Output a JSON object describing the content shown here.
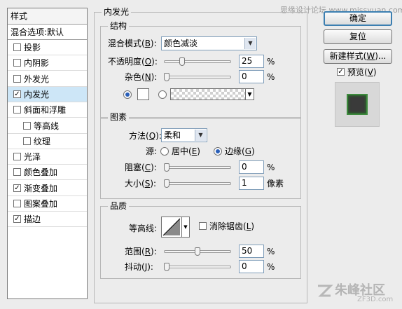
{
  "watermark_top": "思缘设计论坛 www.missyuan.com",
  "watermark_bottom": "朱峰社区",
  "watermark_bottom_sub": "ZF3D.com",
  "sidebar": {
    "header": "样式",
    "blend_options": "混合选项:默认",
    "items": [
      {
        "label": "投影",
        "checked": false
      },
      {
        "label": "内阴影",
        "checked": false
      },
      {
        "label": "外发光",
        "checked": false
      },
      {
        "label": "内发光",
        "checked": true,
        "selected": true
      },
      {
        "label": "斜面和浮雕",
        "checked": false
      },
      {
        "label": "等高线",
        "checked": false,
        "sub": true
      },
      {
        "label": "纹理",
        "checked": false,
        "sub": true
      },
      {
        "label": "光泽",
        "checked": false
      },
      {
        "label": "颜色叠加",
        "checked": false
      },
      {
        "label": "渐变叠加",
        "checked": true
      },
      {
        "label": "图案叠加",
        "checked": false
      },
      {
        "label": "描边",
        "checked": true
      }
    ]
  },
  "panel": {
    "title": "内发光",
    "structure": {
      "title": "结构",
      "blend_mode_label": "混合模式(",
      "blend_mode_key": "B",
      "blend_mode_value": "颜色减淡",
      "opacity_label": "不透明度(",
      "opacity_key": "O",
      "opacity_value": "25",
      "opacity_level": 0.25,
      "noise_label": "杂色(",
      "noise_key": "N",
      "noise_value": "0",
      "noise_level": 0,
      "percent": "%"
    },
    "elements": {
      "title": "图素",
      "method_label": "方法(",
      "method_key": "Q",
      "method_value": "柔和",
      "source_label": "源:",
      "source_center": "居中(",
      "source_center_key": "E",
      "source_edge": "边缘(",
      "source_edge_key": "G",
      "choke_label": "阻塞(",
      "choke_key": "C",
      "choke_value": "0",
      "choke_level": 0,
      "size_label": "大小(",
      "size_key": "S",
      "size_value": "1",
      "size_unit": "像素",
      "percent": "%"
    },
    "quality": {
      "title": "品质",
      "contour_label": "等高线:",
      "antialias_label": "消除锯齿(",
      "antialias_key": "L",
      "range_label": "范围(",
      "range_key": "R",
      "range_value": "50",
      "range_level": 0.5,
      "jitter_label": "抖动(",
      "jitter_key": "J",
      "jitter_value": "0",
      "jitter_level": 0,
      "percent": "%"
    }
  },
  "buttons": {
    "ok": "确定",
    "reset": "复位",
    "new_style_pre": "新建样式(",
    "new_style_key": "W",
    "new_style_post": ")...",
    "preview_pre": "预览(",
    "preview_key": "V",
    "close_paren": ")"
  },
  "colors": {
    "selection": "#cde6f7",
    "default_button_border": "#3c7fb1",
    "preview_swatch": "#3a3a3a",
    "preview_glow": "#3d8a3d"
  }
}
